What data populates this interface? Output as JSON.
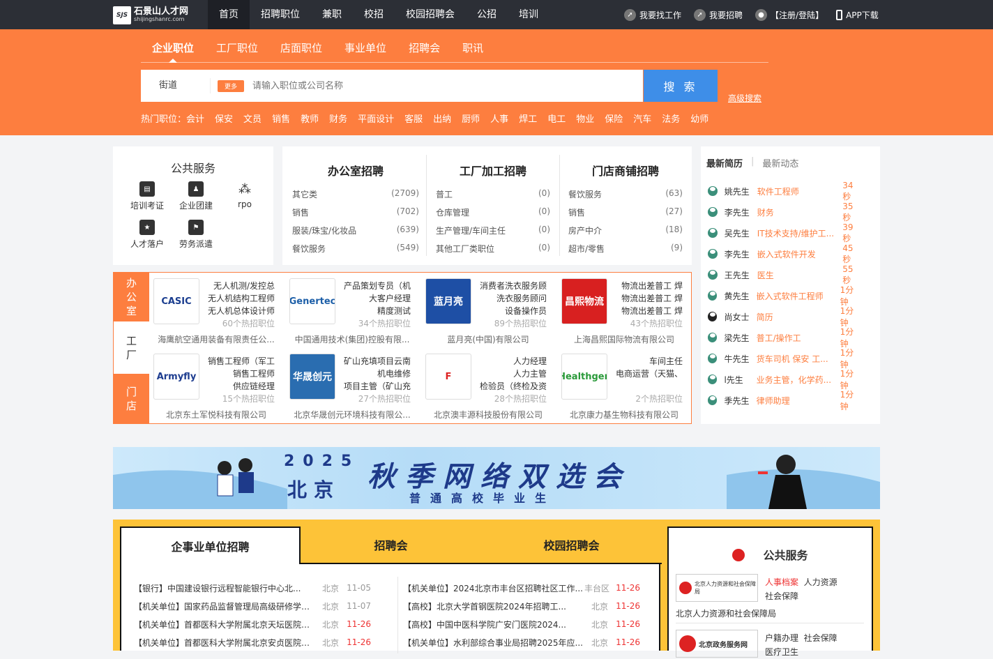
{
  "header": {
    "logo_cn": "石景山人才网",
    "logo_en": "shijingshanrc.com",
    "logo_mark": "SJS",
    "nav": [
      "首页",
      "招聘职位",
      "兼职",
      "校招",
      "校园招聘会",
      "公招",
      "培训"
    ],
    "right": {
      "find_job": "我要找工作",
      "hire": "我要招聘",
      "login": "【注册/登陆】",
      "app": "APP下载"
    }
  },
  "search": {
    "tabs": [
      "企业职位",
      "工厂职位",
      "店面职位",
      "事业单位",
      "招聘会",
      "职讯"
    ],
    "street": "街道",
    "more": "更多",
    "placeholder": "请输入职位或公司名称",
    "button": "搜 索",
    "advanced": "高级搜索",
    "hot_label": "热门职位：",
    "hot": [
      "会计",
      "保安",
      "文员",
      "销售",
      "教师",
      "财务",
      "平面设计",
      "客服",
      "出纳",
      "厨师",
      "人事",
      "焊工",
      "电工",
      "物业",
      "保险",
      "汽车",
      "法务",
      "幼师"
    ]
  },
  "public_service": {
    "title": "公共服务",
    "items": [
      {
        "label": "培训考证",
        "icon": "book-icon"
      },
      {
        "label": "企业团建",
        "icon": "team-icon"
      },
      {
        "label": "rpo",
        "icon": "network-icon"
      },
      {
        "label": "人才落户",
        "icon": "id-card-icon"
      },
      {
        "label": "劳务派遣",
        "icon": "worker-icon"
      }
    ]
  },
  "categories": [
    {
      "title": "办公室招聘",
      "rows": [
        [
          "其它类",
          "(2709)"
        ],
        [
          "销售",
          "(702)"
        ],
        [
          "服装/珠宝/化妆品",
          "(639)"
        ],
        [
          "餐饮服务",
          "(549)"
        ]
      ]
    },
    {
      "title": "工厂加工招聘",
      "rows": [
        [
          "普工",
          "(0)"
        ],
        [
          "仓库管理",
          "(0)"
        ],
        [
          "生产管理/车间主任",
          "(0)"
        ],
        [
          "其他工厂类职位",
          "(0)"
        ]
      ]
    },
    {
      "title": "门店商铺招聘",
      "rows": [
        [
          "餐饮服务",
          "(63)"
        ],
        [
          "销售",
          "(27)"
        ],
        [
          "房产中介",
          "(18)"
        ],
        [
          "超市/零售",
          "(9)"
        ]
      ]
    }
  ],
  "resumes": {
    "tabs": [
      "最新简历",
      "最新动态"
    ],
    "rows": [
      {
        "name": "姚先生",
        "job": "软件工程师",
        "time": "34秒",
        "f": false
      },
      {
        "name": "李先生",
        "job": "财务",
        "time": "35秒",
        "f": false
      },
      {
        "name": "吴先生",
        "job": "IT技术支持/维护工...",
        "time": "39秒",
        "f": false
      },
      {
        "name": "李先生",
        "job": "嵌入式软件开发",
        "time": "45秒",
        "f": false
      },
      {
        "name": "王先生",
        "job": "医生",
        "time": "55秒",
        "f": false
      },
      {
        "name": "黄先生",
        "job": "嵌入式软件工程师",
        "time": "1分钟",
        "f": false
      },
      {
        "name": "尚女士",
        "job": "简历",
        "time": "1分钟",
        "f": true
      },
      {
        "name": "梁先生",
        "job": "普工/操作工",
        "time": "1分钟",
        "f": false
      },
      {
        "name": "牛先生",
        "job": "货车司机 保安 工...",
        "time": "1分钟",
        "f": false
      },
      {
        "name": "l先生",
        "job": "业务主管，化学药...",
        "time": "1分钟",
        "f": false
      },
      {
        "name": "季先生",
        "job": "律师助理",
        "time": "1分钟",
        "f": false
      }
    ]
  },
  "company_side": [
    "办\n公\n室",
    "工\n厂",
    "门\n店"
  ],
  "companies": [
    {
      "logo": "CASIC",
      "color": "#1a3d8f",
      "jobs": "无人机测/发控总\n无人机结构工程师\n无人机总体设计师",
      "hot": "60个热招职位",
      "name": "海鹰航空通用装备有限责任公..."
    },
    {
      "logo": "Genertec",
      "color": "#1d5fa8",
      "jobs": "产品策划专员（机\n大客户经理\n精度测试",
      "hot": "34个热招职位",
      "name": "中国通用技术(集团)控股有限..."
    },
    {
      "logo": "蓝月亮",
      "color": "#1e4fa5",
      "jobs": "消费者洗衣服务顾\n洗衣服务顾问\n设备操作员",
      "hot": "89个热招职位",
      "name": "蓝月亮(中国)有限公司"
    },
    {
      "logo": "昌熙物流",
      "color": "#d82020",
      "jobs": "物流出差普工 焊\n物流出差普工 焊\n物流出差普工 焊",
      "hot": "43个热招职位",
      "name": "上海昌熙国际物流有限公司"
    },
    {
      "logo": "Armyfly",
      "color": "#1d3c8f",
      "jobs": "销售工程师（军工\n销售工程师\n供应链经理",
      "hot": "15个热招职位",
      "name": "北京东土军悦科技有限公司"
    },
    {
      "logo": "华晟创元",
      "color": "#2a6db0",
      "jobs": "矿山充填项目云南\n机电维修\n项目主管（矿山充",
      "hot": "27个热招职位",
      "name": "北京华晟创元环境科技有限公..."
    },
    {
      "logo": "F",
      "color": "#d22",
      "jobs": "人力经理\n人力主管\n检验员（终检及资",
      "hot": "28个热招职位",
      "name": "北京澳丰源科技股份有限公司"
    },
    {
      "logo": "Healthgen",
      "color": "#2a9a3a",
      "jobs": "车间主任\n电商运营（天猫、",
      "hot": "2个热招职位",
      "name": "北京康力基生物科技有限公司"
    }
  ],
  "banner": {
    "year": "2025",
    "city": "北京",
    "main": "秋季网络双选会",
    "sub": "普通高校毕业生"
  },
  "bottom": {
    "tabs": [
      "企事业单位招聘",
      "招聘会",
      "校园招聘会"
    ],
    "left": [
      [
        "【银行】中国建设银行远程智能银行中心北...",
        "北京",
        "11-05"
      ],
      [
        "【机关单位】国家药品监督管理局高级研修学院...",
        "北京",
        "11-07"
      ],
      [
        "【机关单位】首都医科大学附属北京天坛医院面...",
        "北京",
        "11-26"
      ],
      [
        "【机关单位】首都医科大学附属北京安贞医院面...",
        "北京",
        "11-26"
      ]
    ],
    "right": [
      [
        "【机关单位】2024北京市丰台区招聘社区工作...",
        "丰台区",
        "11-26"
      ],
      [
        "【高校】北京大学首钢医院2024年招聘工...",
        "北京",
        "11-26"
      ],
      [
        "【高校】中国中医科学院广安门医院2024...",
        "北京",
        "11-26"
      ],
      [
        "【机关单位】水利部综合事业局招聘2025年应...",
        "北京",
        "11-26"
      ]
    ],
    "pub_title": "公共服务",
    "pub": [
      {
        "org": "北京人力资源和社会保障局",
        "logo": "北京人力资源和社会保障局",
        "tags": [
          "人事档案",
          "人力资源",
          "社会保障"
        ]
      },
      {
        "org": "",
        "logo": "北京政务服务网",
        "tags": [
          "户籍办理",
          "社会保障",
          "医疗卫生"
        ]
      }
    ]
  }
}
